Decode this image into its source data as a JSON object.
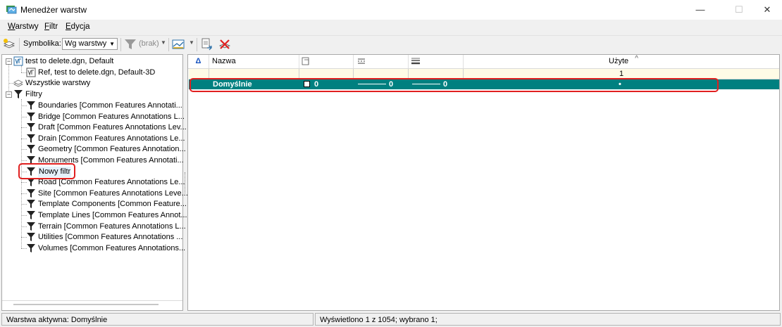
{
  "window": {
    "title": "Menedżer warstw",
    "controls": {
      "minimize": "—",
      "maximize": "☐",
      "close": "✕"
    }
  },
  "menu": [
    {
      "first": "W",
      "rest": "arstwy"
    },
    {
      "first": "F",
      "rest": "iltr"
    },
    {
      "first": "E",
      "rest": "dycja"
    }
  ],
  "toolbar": {
    "symbology_label": "Symbolika:",
    "symbology_value": "Wg warstwy",
    "filter_value": "(brak)"
  },
  "tree": {
    "root_file": "test to delete.dgn, Default",
    "ref_file": "Ref, test to delete.dgn, Default-3D",
    "all_layers": "Wszystkie warstwy",
    "filters_label": "Filtry",
    "filters": [
      "Boundaries [Common Features Annotati...",
      "Bridge [Common Features Annotations L...",
      "Draft [Common Features Annotations Lev...",
      "Drain [Common Features Annotations Le...",
      "Geometry [Common Features Annotation...",
      "Monuments [Common Features Annotati...",
      "Nowy filtr",
      "Road [Common Features Annotations Le...",
      "Site [Common Features Annotations Leve...",
      "Template Components [Common Feature...",
      "Template Lines [Common Features Annot...",
      "Terrain [Common Features Annotations L...",
      "Utilities [Common Features Annotations ...",
      "Volumes [Common Features Annotations..."
    ]
  },
  "grid": {
    "columns": {
      "name": "Nazwa",
      "used": "Użyte"
    },
    "sort_indicator": "^",
    "filter_row": {
      "used": "1"
    },
    "rows": [
      {
        "name": "Domyślnie",
        "color": "0",
        "style": "0",
        "weight": "0",
        "used": "•"
      }
    ]
  },
  "status": {
    "active_layer": "Warstwa aktywna: Domyślnie",
    "summary": "Wyświetlono 1 z 1054; wybrano 1;"
  },
  "colors": {
    "selection": "#008080",
    "filter_row": "#fffbe6",
    "highlight": "#e02020"
  }
}
